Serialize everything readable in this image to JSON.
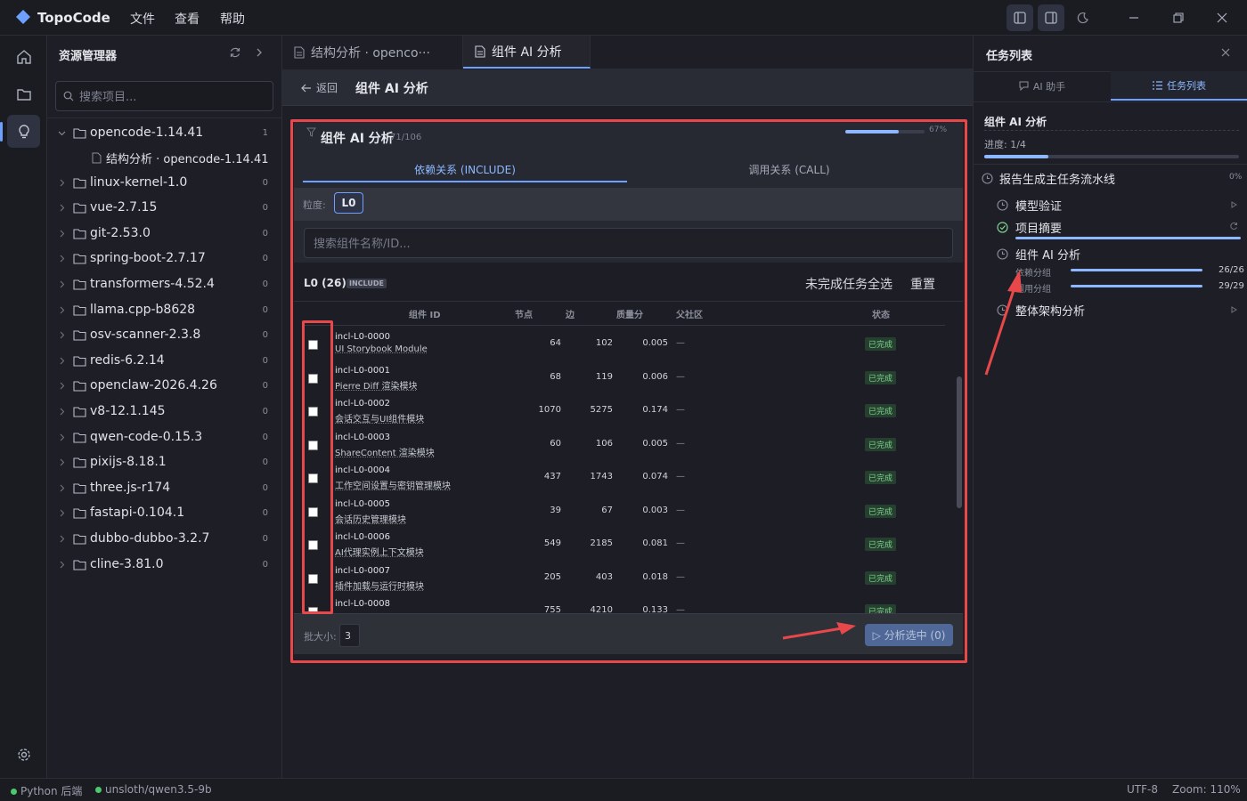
{
  "app": {
    "name": "TopoCode",
    "menus": [
      "文件",
      "查看",
      "帮助"
    ]
  },
  "explorer": {
    "title": "资源管理器",
    "search_placeholder": "搜索项目...",
    "items": [
      {
        "label": "opencode-1.14.41",
        "count": "1",
        "expanded": true
      },
      {
        "label": "结构分析 · opencode-1.14.41",
        "child": true
      },
      {
        "label": "linux-kernel-1.0",
        "count": "0"
      },
      {
        "label": "vue-2.7.15",
        "count": "0"
      },
      {
        "label": "git-2.53.0",
        "count": "0"
      },
      {
        "label": "spring-boot-2.7.17",
        "count": "0"
      },
      {
        "label": "transformers-4.52.4",
        "count": "0"
      },
      {
        "label": "llama.cpp-b8628",
        "count": "0"
      },
      {
        "label": "osv-scanner-2.3.8",
        "count": "0"
      },
      {
        "label": "redis-6.2.14",
        "count": "0"
      },
      {
        "label": "openclaw-2026.4.26",
        "count": "0"
      },
      {
        "label": "v8-12.1.145",
        "count": "0"
      },
      {
        "label": "qwen-code-0.15.3",
        "count": "0"
      },
      {
        "label": "pixijs-8.18.1",
        "count": "0"
      },
      {
        "label": "three.js-r174",
        "count": "0"
      },
      {
        "label": "fastapi-0.104.1",
        "count": "0"
      },
      {
        "label": "dubbo-dubbo-3.2.7",
        "count": "0"
      },
      {
        "label": "cline-3.81.0",
        "count": "0"
      }
    ]
  },
  "tabs": [
    {
      "label": "结构分析 · openco···",
      "active": false
    },
    {
      "label": "组件 AI 分析",
      "active": true
    }
  ],
  "crumb": {
    "back": "返回",
    "title": "组件 AI 分析"
  },
  "panel": {
    "title": "组件 AI 分析",
    "count": "71/106",
    "progress_label": "67%",
    "progress": 0.67,
    "subtabs": [
      "依赖关系 (INCLUDE)",
      "调用关系 (CALL)"
    ],
    "granularity_label": "粒度:",
    "granularity": "L0",
    "search_placeholder": "搜索组件名称/ID...",
    "level_label": "L0 (26)",
    "level_tag": "INCLUDE",
    "select_all": "未完成任务全选",
    "reset": "重置",
    "columns": {
      "id": "组件 ID",
      "nodes": "节点",
      "edges": "边",
      "score": "质量分",
      "parent": "父社区",
      "status": "状态"
    },
    "rows": [
      {
        "id": "incl-L0-0000",
        "name": "UI Storybook Module",
        "nodes": "64",
        "edges": "102",
        "score": "0.005",
        "parent": "—",
        "status": "已完成"
      },
      {
        "id": "incl-L0-0001",
        "name": "Pierre Diff 渲染模块",
        "nodes": "68",
        "edges": "119",
        "score": "0.006",
        "parent": "—",
        "status": "已完成"
      },
      {
        "id": "incl-L0-0002",
        "name": "会话交互与UI组件模块",
        "nodes": "1070",
        "edges": "5275",
        "score": "0.174",
        "parent": "—",
        "status": "已完成"
      },
      {
        "id": "incl-L0-0003",
        "name": "ShareContent 渲染模块",
        "nodes": "60",
        "edges": "106",
        "score": "0.005",
        "parent": "—",
        "status": "已完成"
      },
      {
        "id": "incl-L0-0004",
        "name": "工作空间设置与密钥管理模块",
        "nodes": "437",
        "edges": "1743",
        "score": "0.074",
        "parent": "—",
        "status": "已完成"
      },
      {
        "id": "incl-L0-0005",
        "name": "会话历史管理模块",
        "nodes": "39",
        "edges": "67",
        "score": "0.003",
        "parent": "—",
        "status": "已完成"
      },
      {
        "id": "incl-L0-0006",
        "name": "AI代理实例上下文模块",
        "nodes": "549",
        "edges": "2185",
        "score": "0.081",
        "parent": "—",
        "status": "已完成"
      },
      {
        "id": "incl-L0-0007",
        "name": "插件加载与运行时模块",
        "nodes": "205",
        "edges": "403",
        "score": "0.018",
        "parent": "—",
        "status": "已完成"
      },
      {
        "id": "incl-L0-0008",
        "name": "",
        "nodes": "755",
        "edges": "4210",
        "score": "0.133",
        "parent": "—",
        "status": "已完成"
      }
    ],
    "batch_label": "批大小:",
    "batch_value": "3",
    "analyze_button": "▷ 分析选中 (0)"
  },
  "right": {
    "title": "任务列表",
    "tabs": [
      "AI 助手",
      "任务列表"
    ],
    "section_title": "组件 AI 分析",
    "progress_text": "进度: 1/4",
    "progress": 0.25,
    "pipeline": "报告生成主任务流水线",
    "pipeline_pct": "0%",
    "tasks": [
      {
        "label": "模型验证",
        "state": "pending"
      },
      {
        "label": "项目摘要",
        "state": "done"
      },
      {
        "label": "组件 AI 分析",
        "state": "running"
      },
      {
        "label": "整体架构分析",
        "state": "pending"
      }
    ],
    "subprogress": [
      {
        "label": "依赖分组",
        "value": "26/26"
      },
      {
        "label": "调用分组",
        "value": "29/29"
      }
    ]
  },
  "status": {
    "backend": "Python 后端",
    "model": "unsloth/qwen3.5-9b",
    "encoding": "UTF-8",
    "zoom": "Zoom: 110%"
  },
  "colors": {
    "accent": "#6ea1ff",
    "annotation": "#e8484a",
    "done": "#7fd18f"
  }
}
